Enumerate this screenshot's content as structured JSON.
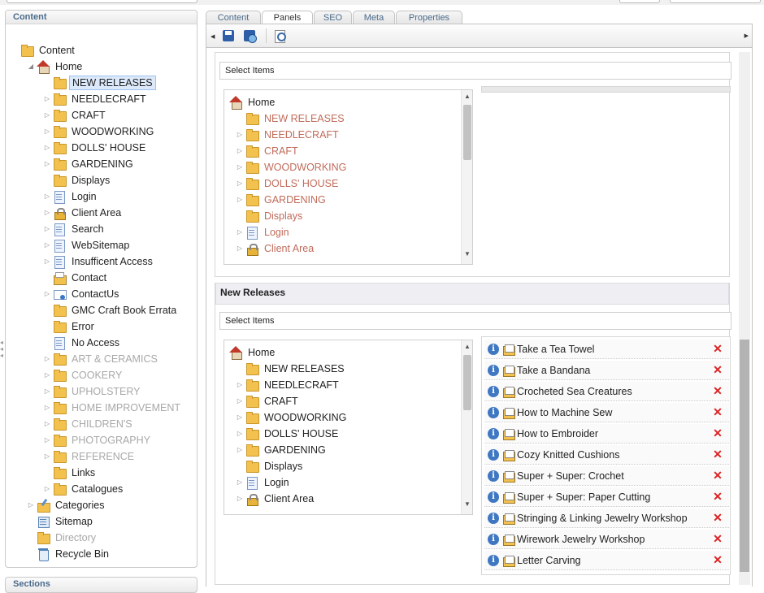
{
  "left_panel": {
    "title": "Content",
    "sections_title": "Sections",
    "tree": [
      {
        "label": "Content",
        "icon": "folder-icon",
        "level": 0
      },
      {
        "label": "Home",
        "icon": "home-icon",
        "level": 1
      },
      {
        "label": "NEW RELEASES",
        "icon": "folder-icon",
        "level": 2,
        "selected": true
      },
      {
        "label": "NEEDLECRAFT",
        "icon": "folder-icon",
        "level": 2
      },
      {
        "label": "CRAFT",
        "icon": "folder-icon",
        "level": 2
      },
      {
        "label": "WOODWORKING",
        "icon": "folder-icon",
        "level": 2
      },
      {
        "label": "DOLLS' HOUSE",
        "icon": "folder-icon",
        "level": 2
      },
      {
        "label": "GARDENING",
        "icon": "folder-icon",
        "level": 2
      },
      {
        "label": "Displays",
        "icon": "folder-icon",
        "level": 2
      },
      {
        "label": "Login",
        "icon": "page-icon",
        "level": 2
      },
      {
        "label": "Client Area",
        "icon": "lock-icon",
        "level": 2
      },
      {
        "label": "Search",
        "icon": "page-icon",
        "level": 2
      },
      {
        "label": "WebSitemap",
        "icon": "page-icon",
        "level": 2
      },
      {
        "label": "Insufficent Access",
        "icon": "page-icon",
        "level": 2
      },
      {
        "label": "Contact",
        "icon": "contact-icon",
        "level": 2
      },
      {
        "label": "ContactUs",
        "icon": "mail-icon",
        "level": 2
      },
      {
        "label": "GMC Craft Book Errata",
        "icon": "folder-icon",
        "level": 2
      },
      {
        "label": "Error",
        "icon": "folder-icon",
        "level": 2
      },
      {
        "label": "No Access",
        "icon": "page-icon",
        "level": 2
      },
      {
        "label": "ART & CERAMICS",
        "icon": "folder-icon",
        "level": 2,
        "dim": true
      },
      {
        "label": "COOKERY",
        "icon": "folder-icon",
        "level": 2,
        "dim": true
      },
      {
        "label": "UPHOLSTERY",
        "icon": "folder-icon",
        "level": 2,
        "dim": true
      },
      {
        "label": "HOME IMPROVEMENT",
        "icon": "folder-icon",
        "level": 2,
        "dim": true
      },
      {
        "label": "CHILDREN'S",
        "icon": "folder-icon",
        "level": 2,
        "dim": true
      },
      {
        "label": "PHOTOGRAPHY",
        "icon": "folder-icon",
        "level": 2,
        "dim": true
      },
      {
        "label": "REFERENCE",
        "icon": "folder-icon",
        "level": 2,
        "dim": true
      },
      {
        "label": "Links",
        "icon": "folder-icon",
        "level": 2
      },
      {
        "label": "Catalogues",
        "icon": "folder-icon",
        "level": 2
      },
      {
        "label": "Categories",
        "icon": "categories-icon",
        "level": 1
      },
      {
        "label": "Sitemap",
        "icon": "sitemap-icon",
        "level": 1
      },
      {
        "label": "Directory",
        "icon": "folder-icon",
        "level": 1,
        "dim": true
      },
      {
        "label": "Recycle Bin",
        "icon": "recycle-bin-icon",
        "level": 1
      }
    ]
  },
  "tabs": [
    {
      "label": "Content",
      "active": false
    },
    {
      "label": "Panels",
      "active": true
    },
    {
      "label": "SEO",
      "active": false
    },
    {
      "label": "Meta",
      "active": false
    },
    {
      "label": "Properties",
      "active": false
    }
  ],
  "toolbar": {
    "save_icon": "save-icon",
    "save_close_icon": "save-close-icon",
    "preview_icon": "preview-icon"
  },
  "panel_top": {
    "select_label": "Select Items",
    "tree": [
      {
        "label": "Home",
        "icon": "home-icon",
        "level": 0,
        "red": false
      },
      {
        "label": "NEW RELEASES",
        "icon": "folder-icon",
        "level": 1,
        "red": true
      },
      {
        "label": "NEEDLECRAFT",
        "icon": "folder-icon",
        "level": 1,
        "red": true
      },
      {
        "label": "CRAFT",
        "icon": "folder-icon",
        "level": 1,
        "red": true
      },
      {
        "label": "WOODWORKING",
        "icon": "folder-icon",
        "level": 1,
        "red": true
      },
      {
        "label": "DOLLS' HOUSE",
        "icon": "folder-icon",
        "level": 1,
        "red": true
      },
      {
        "label": "GARDENING",
        "icon": "folder-icon",
        "level": 1,
        "red": true
      },
      {
        "label": "Displays",
        "icon": "folder-icon",
        "level": 1,
        "red": true
      },
      {
        "label": "Login",
        "icon": "page-icon",
        "level": 1,
        "red": true
      },
      {
        "label": "Client Area",
        "icon": "lock-icon",
        "level": 1,
        "red": true
      }
    ]
  },
  "panel_new_releases": {
    "title": "New Releases",
    "select_label": "Select Items",
    "tree": [
      {
        "label": "Home",
        "icon": "home-icon",
        "level": 0
      },
      {
        "label": "NEW RELEASES",
        "icon": "folder-icon",
        "level": 1
      },
      {
        "label": "NEEDLECRAFT",
        "icon": "folder-icon",
        "level": 1
      },
      {
        "label": "CRAFT",
        "icon": "folder-icon",
        "level": 1
      },
      {
        "label": "WOODWORKING",
        "icon": "folder-icon",
        "level": 1
      },
      {
        "label": "DOLLS' HOUSE",
        "icon": "folder-icon",
        "level": 1
      },
      {
        "label": "GARDENING",
        "icon": "folder-icon",
        "level": 1
      },
      {
        "label": "Displays",
        "icon": "folder-icon",
        "level": 1
      },
      {
        "label": "Login",
        "icon": "page-icon",
        "level": 1
      },
      {
        "label": "Client Area",
        "icon": "lock-icon",
        "level": 1
      }
    ],
    "selected_items": [
      "Take a Tea Towel",
      "Take a Bandana",
      "Crocheted Sea Creatures",
      "How to Machine Sew",
      "How to Embroider",
      "Cozy Knitted Cushions",
      "Super + Super: Crochet",
      "Super + Super: Paper Cutting",
      "Stringing & Linking Jewelry Workshop",
      "Wirework Jewelry Workshop",
      "Letter Carving"
    ]
  },
  "colors": {
    "accent_text": "#4a6a8a",
    "red_link": "#c16b5a",
    "delete_x": "#dd2222",
    "info": "#3f77c2"
  }
}
